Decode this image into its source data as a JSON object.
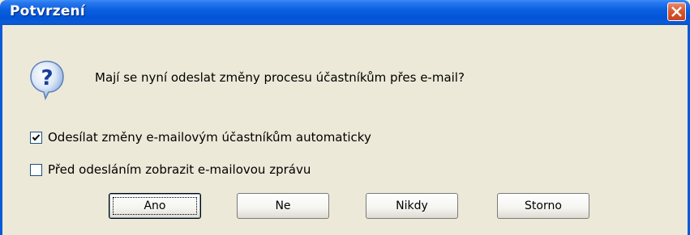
{
  "dialog": {
    "title": "Potvrzení",
    "message": "Mají se nyní odeslat změny procesu účastníkům přes e-mail?",
    "icon": "question-icon"
  },
  "checkboxes": [
    {
      "label": "Odesílat změny e-mailovým účastníkům automaticky",
      "checked": true
    },
    {
      "label": "Před odesláním zobrazit e-mailovou zprávu",
      "checked": false
    }
  ],
  "buttons": {
    "yes": "Ano",
    "no": "Ne",
    "never": "Nikdy",
    "cancel": "Storno"
  },
  "colors": {
    "titlebar": "#0a5fe0",
    "close": "#d9582f",
    "background": "#ece9d8"
  }
}
